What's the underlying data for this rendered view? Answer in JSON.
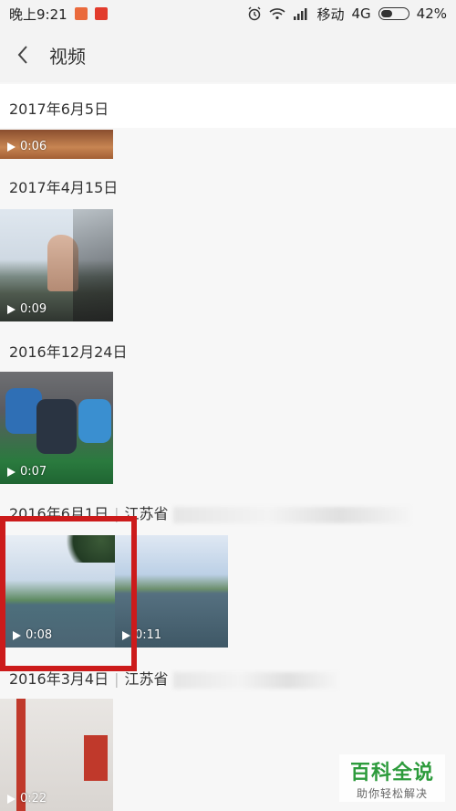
{
  "status_bar": {
    "time": "晚上9:21",
    "carrier": "移动",
    "network": "4G",
    "battery": "42%",
    "battery_level": 0.42
  },
  "header": {
    "title": "视频"
  },
  "sections": [
    {
      "date": "2017年6月5日",
      "videos": [
        {
          "duration": "0:06"
        }
      ]
    },
    {
      "date": "2017年4月15日",
      "videos": [
        {
          "duration": "0:09"
        }
      ]
    },
    {
      "date": "2016年12月24日",
      "videos": [
        {
          "duration": "0:07"
        }
      ]
    },
    {
      "date": "2016年6月1日",
      "location": "江苏省",
      "videos": [
        {
          "duration": "0:08"
        },
        {
          "duration": "0:11"
        }
      ]
    },
    {
      "date": "2016年3月4日",
      "location": "江苏省",
      "videos": [
        {
          "duration": "0:22"
        }
      ]
    }
  ],
  "watermark": {
    "title": "百科全说",
    "subtitle": "助你轻松解决"
  },
  "colors": {
    "highlight": "#cc1b1b",
    "watermark_green": "#2d9b3c"
  }
}
